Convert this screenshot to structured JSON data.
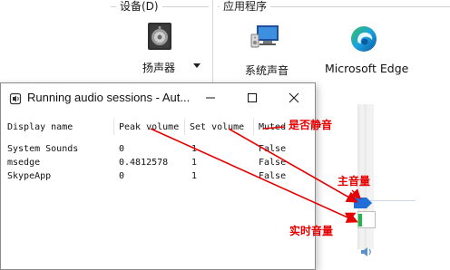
{
  "mixer": {
    "device_group_label": "设备(D)",
    "apps_group_label": "应用程序",
    "device_name": "扬声器",
    "system_sounds_label": "系统声音",
    "edge_label": "Microsoft Edge"
  },
  "window": {
    "title": "Running audio sessions - Aut...",
    "columns": [
      "Display name",
      "Peak volume",
      "Set volume",
      "Muted"
    ],
    "rows": [
      [
        "System Sounds",
        "0",
        "1",
        "False"
      ],
      [
        "msedge",
        "0.4812578",
        "1",
        "False"
      ],
      [
        "SkypeApp",
        "0",
        "1",
        "False"
      ]
    ]
  },
  "annotations": {
    "mute_label": "是否静音",
    "master_label": "主音量",
    "realtime_label": "实时音量"
  },
  "colors": {
    "annotation": "#e60000",
    "master_handle": "#1f6fd6",
    "meter": "#1eb84a",
    "edge_blue": "#0c59a4",
    "edge_green": "#36c15a"
  }
}
